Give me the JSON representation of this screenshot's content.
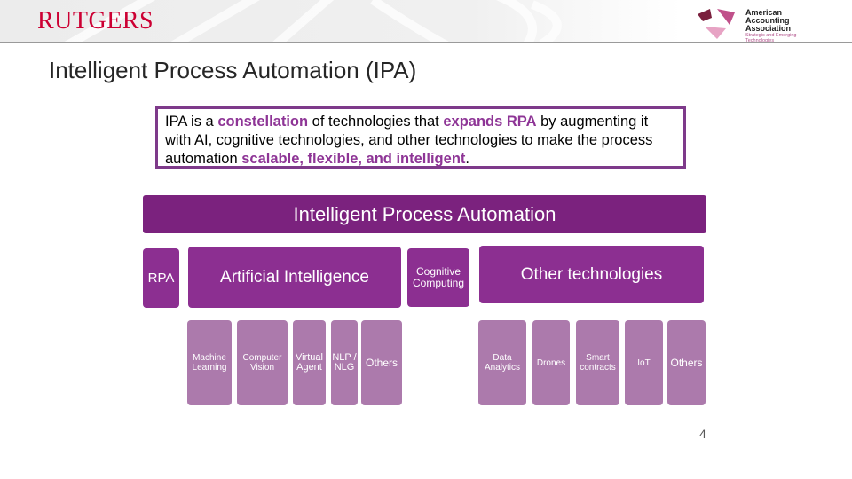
{
  "header": {
    "university_logo": "RUTGERS",
    "association_logo": {
      "name_lines": [
        "American",
        "Accounting",
        "Association"
      ],
      "subtitle_lines": [
        "Strategic and Emerging",
        "Technologies"
      ]
    }
  },
  "slide": {
    "title": "Intelligent Process Automation (IPA)",
    "definition": {
      "p1": "IPA is a ",
      "h1": "constellation",
      "p2": " of technologies that ",
      "h2": "expands RPA",
      "p3": " by augmenting it with AI, cognitive technologies, and other technologies to make the process automation ",
      "h3": "scalable, flexible, and intelligent",
      "p4": "."
    },
    "diagram": {
      "top": "Intelligent Process Automation",
      "rpa": "RPA",
      "ai": "Artificial Intelligence",
      "cognitive": [
        "Cognitive",
        "Computing"
      ],
      "other": "Other technologies",
      "ai_children": [
        [
          "Machine",
          "Learning"
        ],
        [
          "Computer",
          "Vision"
        ],
        [
          "Virtual",
          "Agent"
        ],
        [
          "NLP /",
          "NLG"
        ],
        [
          "Others"
        ]
      ],
      "other_children": [
        [
          "Data",
          "Analytics"
        ],
        [
          "Drones"
        ],
        [
          "Smart",
          "contracts"
        ],
        [
          "IoT"
        ],
        [
          "Others"
        ]
      ]
    },
    "page_number": "4"
  },
  "colors": {
    "rutgers_red": "#cc0033",
    "top_bar": "#7b227e",
    "level2": "#8c2f91",
    "level3": "#ac7aac",
    "highlight": "#8e3596",
    "definition_border": "#7e3a8a"
  }
}
